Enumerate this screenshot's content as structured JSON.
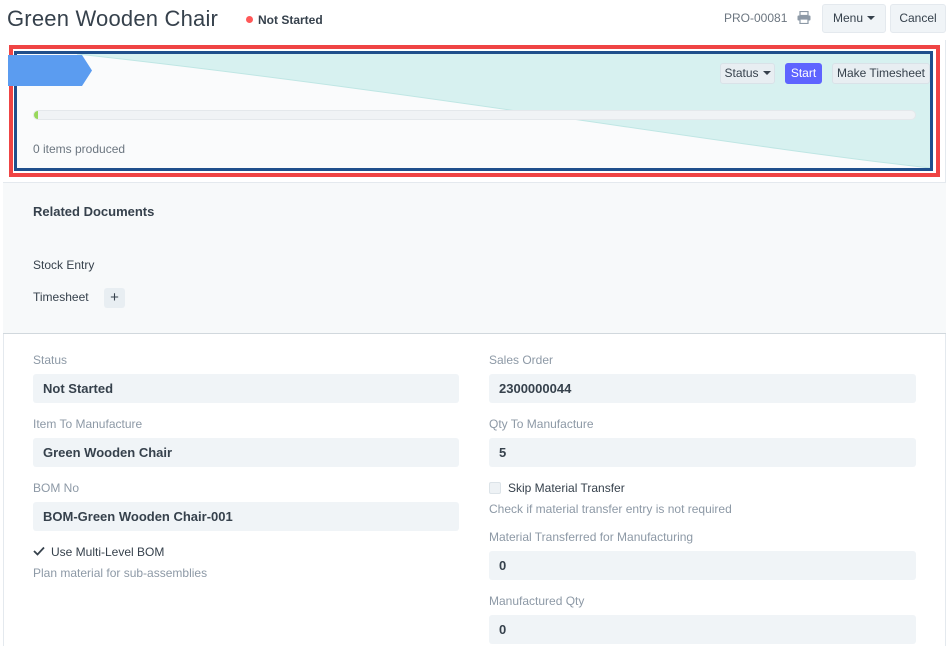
{
  "header": {
    "title": "Green Wooden Chair",
    "status": "Not Started",
    "status_color": "#ff5858",
    "doc_name": "PRO-00081",
    "print_icon": "print-icon",
    "menu_label": "Menu",
    "cancel_label": "Cancel"
  },
  "dashboard": {
    "status_label": "Status",
    "start_label": "Start",
    "make_timesheet_label": "Make Timesheet",
    "progress_percent": 0,
    "items_produced": "0 items produced",
    "accent_color": "#5e64ff",
    "progress_color": "#98d85b"
  },
  "related": {
    "title": "Related Documents",
    "stock_entry": "Stock Entry",
    "timesheet": "Timesheet",
    "add_label": "+"
  },
  "form": {
    "status_label": "Status",
    "status_value": "Not Started",
    "item_label": "Item To Manufacture",
    "item_value": "Green Wooden Chair",
    "bom_label": "BOM No",
    "bom_value": "BOM-Green Wooden Chair-001",
    "multi_level_label": "Use Multi-Level BOM",
    "multi_level_checked": true,
    "multi_level_help": "Plan material for sub-assemblies",
    "sales_order_label": "Sales Order",
    "sales_order_value": "2300000044",
    "qty_label": "Qty To Manufacture",
    "qty_value": "5",
    "skip_label": "Skip Material Transfer",
    "skip_checked": false,
    "skip_help": "Check if material transfer entry is not required",
    "transferred_label": "Material Transferred for Manufacturing",
    "transferred_value": "0",
    "manufactured_label": "Manufactured Qty",
    "manufactured_value": "0"
  }
}
